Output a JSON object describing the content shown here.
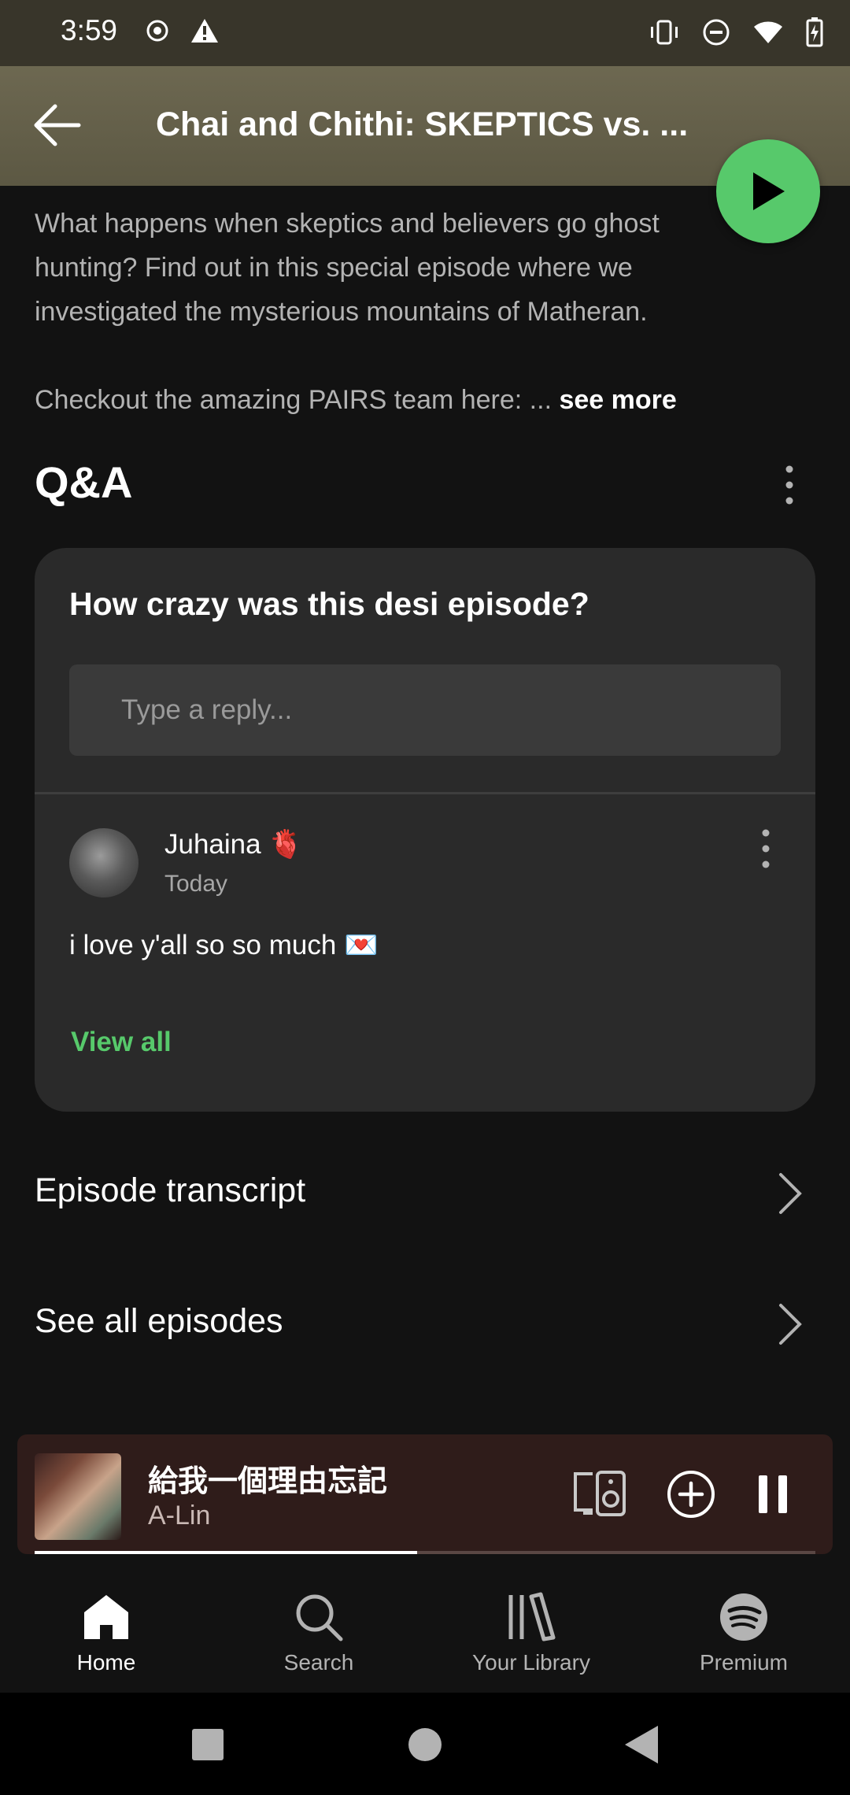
{
  "status_bar": {
    "time": "3:59"
  },
  "header": {
    "title": "Chai and Chithi: SKEPTICS vs. ..."
  },
  "description": {
    "paragraph1": "What happens when skeptics and believers go ghost hunting? Find out in this special episode where we investigated the mysterious mountains of Matheran.",
    "paragraph2": "Checkout the amazing PAIRS team here: ...",
    "see_more": "see more"
  },
  "qa": {
    "title": "Q&A",
    "question": "How crazy was this desi episode?",
    "reply_placeholder": "Type a reply...",
    "comment": {
      "author": "Juhaina 🫀",
      "time": "Today",
      "text": "i love y'all so so much 💌"
    },
    "view_all": "View all"
  },
  "rows": {
    "transcript": "Episode transcript",
    "all_episodes": "See all episodes"
  },
  "now_playing": {
    "title": "給我一個理由忘記",
    "artist": "A-Lin",
    "progress": 0.49
  },
  "bottom_nav": {
    "items": [
      {
        "label": "Home",
        "icon": "home-icon",
        "active": true
      },
      {
        "label": "Search",
        "icon": "search-icon",
        "active": false
      },
      {
        "label": "Your Library",
        "icon": "library-icon",
        "active": false
      },
      {
        "label": "Premium",
        "icon": "spotify-icon",
        "active": false
      }
    ]
  },
  "colors": {
    "accent_green": "#57c96b",
    "header_bg": "#6d6851",
    "player_bg": "#2f1c1a"
  }
}
